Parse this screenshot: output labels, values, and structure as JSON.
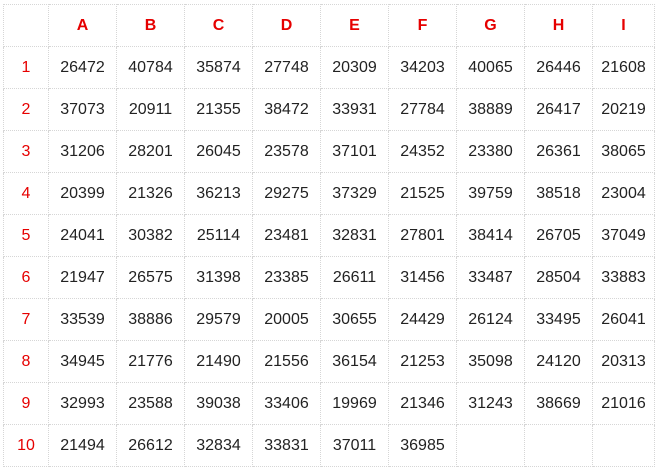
{
  "header_color": "#e60000",
  "columns": [
    "A",
    "B",
    "C",
    "D",
    "E",
    "F",
    "G",
    "H",
    "I"
  ],
  "rows": [
    {
      "label": "1",
      "cells": [
        "26472",
        "40784",
        "35874",
        "27748",
        "20309",
        "34203",
        "40065",
        "26446",
        "21608"
      ]
    },
    {
      "label": "2",
      "cells": [
        "37073",
        "20911",
        "21355",
        "38472",
        "33931",
        "27784",
        "38889",
        "26417",
        "20219"
      ]
    },
    {
      "label": "3",
      "cells": [
        "31206",
        "28201",
        "26045",
        "23578",
        "37101",
        "24352",
        "23380",
        "26361",
        "38065"
      ]
    },
    {
      "label": "4",
      "cells": [
        "20399",
        "21326",
        "36213",
        "29275",
        "37329",
        "21525",
        "39759",
        "38518",
        "23004"
      ]
    },
    {
      "label": "5",
      "cells": [
        "24041",
        "30382",
        "25114",
        "23481",
        "32831",
        "27801",
        "38414",
        "26705",
        "37049"
      ]
    },
    {
      "label": "6",
      "cells": [
        "21947",
        "26575",
        "31398",
        "23385",
        "26611",
        "31456",
        "33487",
        "28504",
        "33883"
      ]
    },
    {
      "label": "7",
      "cells": [
        "33539",
        "38886",
        "29579",
        "20005",
        "30655",
        "24429",
        "26124",
        "33495",
        "26041"
      ]
    },
    {
      "label": "8",
      "cells": [
        "34945",
        "21776",
        "21490",
        "21556",
        "36154",
        "21253",
        "35098",
        "24120",
        "20313"
      ]
    },
    {
      "label": "9",
      "cells": [
        "32993",
        "23588",
        "39038",
        "33406",
        "19969",
        "21346",
        "31243",
        "38669",
        "21016"
      ]
    },
    {
      "label": "10",
      "cells": [
        "21494",
        "26612",
        "32834",
        "33831",
        "37011",
        "36985",
        "",
        "",
        ""
      ]
    }
  ]
}
